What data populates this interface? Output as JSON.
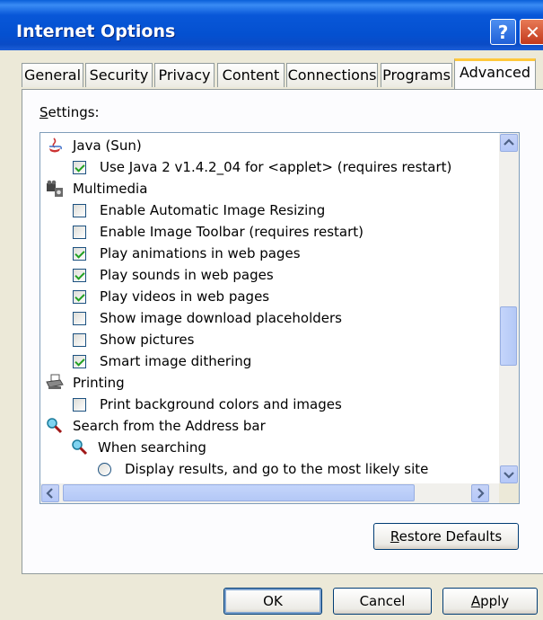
{
  "window": {
    "title": "Internet Options"
  },
  "titlebar_buttons": {
    "help": "?",
    "close": "✕"
  },
  "tabs": [
    {
      "label": "General",
      "active": false
    },
    {
      "label": "Security",
      "active": false
    },
    {
      "label": "Privacy",
      "active": false
    },
    {
      "label": "Content",
      "active": false
    },
    {
      "label": "Connections",
      "active": false
    },
    {
      "label": "Programs",
      "active": false
    },
    {
      "label": "Advanced",
      "active": true
    }
  ],
  "settings": {
    "label_first": "S",
    "label_rest": "ettings:",
    "items": [
      {
        "type": "group",
        "icon": "java-icon",
        "label": "Java (Sun)"
      },
      {
        "type": "checkbox",
        "checked": true,
        "label": "Use Java 2 v1.4.2_04 for <applet> (requires restart)"
      },
      {
        "type": "group",
        "icon": "multimedia-icon",
        "label": "Multimedia"
      },
      {
        "type": "checkbox",
        "checked": false,
        "label": "Enable Automatic Image Resizing"
      },
      {
        "type": "checkbox",
        "checked": false,
        "label": "Enable Image Toolbar (requires restart)"
      },
      {
        "type": "checkbox",
        "checked": true,
        "label": "Play animations in web pages"
      },
      {
        "type": "checkbox",
        "checked": true,
        "label": "Play sounds in web pages"
      },
      {
        "type": "checkbox",
        "checked": true,
        "label": "Play videos in web pages"
      },
      {
        "type": "checkbox",
        "checked": false,
        "label": "Show image download placeholders"
      },
      {
        "type": "checkbox",
        "checked": false,
        "label": "Show pictures"
      },
      {
        "type": "checkbox",
        "checked": true,
        "label": "Smart image dithering"
      },
      {
        "type": "group",
        "icon": "printer-icon",
        "label": "Printing"
      },
      {
        "type": "checkbox",
        "checked": false,
        "label": "Print background colors and images"
      },
      {
        "type": "group",
        "icon": "search-icon",
        "label": "Search from the Address bar"
      },
      {
        "type": "subgroup",
        "icon": "search-icon",
        "label": "When searching"
      },
      {
        "type": "radio",
        "checked": false,
        "label": "Display results, and go to the most likely site"
      }
    ]
  },
  "buttons": {
    "restore_first": "R",
    "restore_rest": "estore Defaults",
    "ok": "OK",
    "cancel": "Cancel",
    "apply_first": "A",
    "apply_rest": "pply"
  },
  "colors": {
    "titlebar": "#0450d0",
    "check": "#21a121",
    "active_tab": "#ffc83c"
  }
}
